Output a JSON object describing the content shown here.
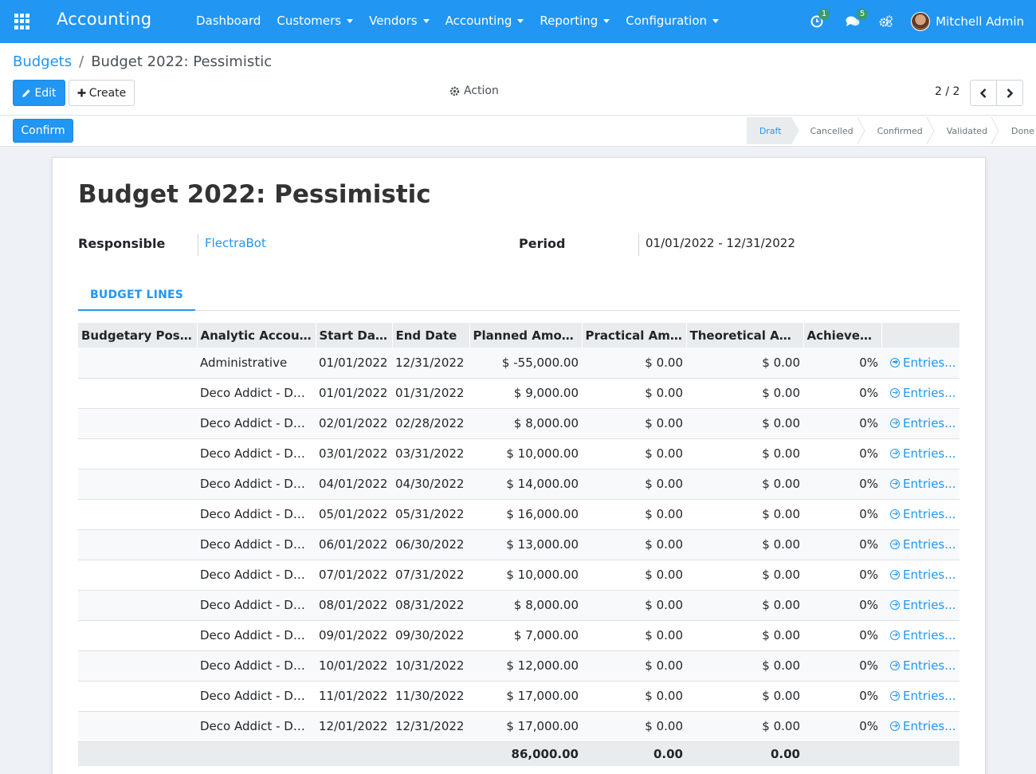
{
  "navbar": {
    "brand": "Accounting",
    "menu": [
      {
        "label": "Dashboard",
        "dropdown": false
      },
      {
        "label": "Customers",
        "dropdown": true
      },
      {
        "label": "Vendors",
        "dropdown": true
      },
      {
        "label": "Accounting",
        "dropdown": true
      },
      {
        "label": "Reporting",
        "dropdown": true
      },
      {
        "label": "Configuration",
        "dropdown": true
      }
    ],
    "activity_badge": "1",
    "messages_badge": "5",
    "user_name": "Mitchell Admin"
  },
  "breadcrumb": {
    "parent": "Budgets",
    "separator": "/",
    "current": "Budget 2022: Pessimistic"
  },
  "buttons": {
    "edit": "Edit",
    "create": "Create",
    "action": "Action",
    "confirm": "Confirm"
  },
  "pager": {
    "value": "2 / 2"
  },
  "status": {
    "stages": [
      "Draft",
      "Cancelled",
      "Confirmed",
      "Validated",
      "Done"
    ],
    "active": "Draft"
  },
  "form": {
    "title": "Budget 2022: Pessimistic",
    "responsible_label": "Responsible",
    "responsible_value": "FlectraBot",
    "period_label": "Period",
    "period_value": "01/01/2022 - 12/31/2022",
    "tab_label": "BUDGET LINES"
  },
  "table": {
    "columns": [
      "Budgetary Positio...",
      "Analytic Account",
      "Start Date",
      "End Date",
      "Planned Amount",
      "Practical Amount",
      "Theoretical Amount",
      "Achievement",
      ""
    ],
    "entries_label": "Entries...",
    "rows": [
      {
        "position": "",
        "account": "Administrative",
        "start": "01/01/2022",
        "end": "12/31/2022",
        "planned": "$ -55,000.00",
        "practical": "$ 0.00",
        "theoretical": "$ 0.00",
        "achievement": "0%"
      },
      {
        "position": "",
        "account": "Deco Addict - Dec...",
        "start": "01/01/2022",
        "end": "01/31/2022",
        "planned": "$ 9,000.00",
        "practical": "$ 0.00",
        "theoretical": "$ 0.00",
        "achievement": "0%"
      },
      {
        "position": "",
        "account": "Deco Addict - Dec...",
        "start": "02/01/2022",
        "end": "02/28/2022",
        "planned": "$ 8,000.00",
        "practical": "$ 0.00",
        "theoretical": "$ 0.00",
        "achievement": "0%"
      },
      {
        "position": "",
        "account": "Deco Addict - Dec...",
        "start": "03/01/2022",
        "end": "03/31/2022",
        "planned": "$ 10,000.00",
        "practical": "$ 0.00",
        "theoretical": "$ 0.00",
        "achievement": "0%"
      },
      {
        "position": "",
        "account": "Deco Addict - Dec...",
        "start": "04/01/2022",
        "end": "04/30/2022",
        "planned": "$ 14,000.00",
        "practical": "$ 0.00",
        "theoretical": "$ 0.00",
        "achievement": "0%"
      },
      {
        "position": "",
        "account": "Deco Addict - Dec...",
        "start": "05/01/2022",
        "end": "05/31/2022",
        "planned": "$ 16,000.00",
        "practical": "$ 0.00",
        "theoretical": "$ 0.00",
        "achievement": "0%"
      },
      {
        "position": "",
        "account": "Deco Addict - Dec...",
        "start": "06/01/2022",
        "end": "06/30/2022",
        "planned": "$ 13,000.00",
        "practical": "$ 0.00",
        "theoretical": "$ 0.00",
        "achievement": "0%"
      },
      {
        "position": "",
        "account": "Deco Addict - Dec...",
        "start": "07/01/2022",
        "end": "07/31/2022",
        "planned": "$ 10,000.00",
        "practical": "$ 0.00",
        "theoretical": "$ 0.00",
        "achievement": "0%"
      },
      {
        "position": "",
        "account": "Deco Addict - Dec...",
        "start": "08/01/2022",
        "end": "08/31/2022",
        "planned": "$ 8,000.00",
        "practical": "$ 0.00",
        "theoretical": "$ 0.00",
        "achievement": "0%"
      },
      {
        "position": "",
        "account": "Deco Addict - Dec...",
        "start": "09/01/2022",
        "end": "09/30/2022",
        "planned": "$ 7,000.00",
        "practical": "$ 0.00",
        "theoretical": "$ 0.00",
        "achievement": "0%"
      },
      {
        "position": "",
        "account": "Deco Addict - Dec...",
        "start": "10/01/2022",
        "end": "10/31/2022",
        "planned": "$ 12,000.00",
        "practical": "$ 0.00",
        "theoretical": "$ 0.00",
        "achievement": "0%"
      },
      {
        "position": "",
        "account": "Deco Addict - Dec...",
        "start": "11/01/2022",
        "end": "11/30/2022",
        "planned": "$ 17,000.00",
        "practical": "$ 0.00",
        "theoretical": "$ 0.00",
        "achievement": "0%"
      },
      {
        "position": "",
        "account": "Deco Addict - Dec...",
        "start": "12/01/2022",
        "end": "12/31/2022",
        "planned": "$ 17,000.00",
        "practical": "$ 0.00",
        "theoretical": "$ 0.00",
        "achievement": "0%"
      }
    ],
    "totals": {
      "planned": "86,000.00",
      "practical": "0.00",
      "theoretical": "0.00"
    }
  },
  "colors": {
    "primary": "#2196f3",
    "badge": "#3a9b6e"
  }
}
